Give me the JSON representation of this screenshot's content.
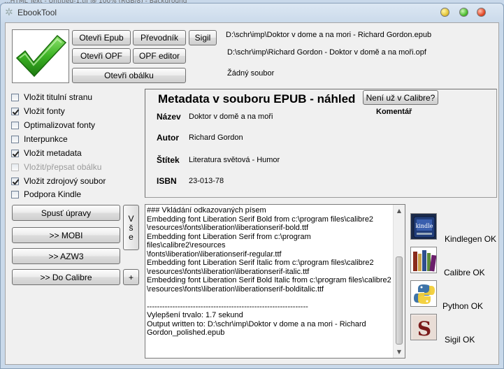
{
  "background_caption": "...HTML Text - Untitled-1.tif @ 100% (RGB/8) - Background",
  "window": {
    "title": "EbookTool"
  },
  "top_buttons": {
    "open_epub": "Otevři Epub",
    "converter": "Převodník",
    "sigil": "Sigil",
    "open_opf": "Otevři OPF",
    "opf_editor": "OPF editor",
    "open_cover": "Otevři obálku"
  },
  "paths": {
    "epub": "D:\\schr\\imp\\Doktor v dome a na mori - Richard Gordon.epub",
    "opf": "D:\\schr\\imp\\Richard Gordon - Doktor v domě a na moři.opf",
    "cover": "Žádný soubor"
  },
  "options": [
    {
      "label": "Vložit titulní stranu",
      "checked": false,
      "enabled": true
    },
    {
      "label": "Vložit fonty",
      "checked": true,
      "enabled": true
    },
    {
      "label": "Optimalizovat fonty",
      "checked": false,
      "enabled": true
    },
    {
      "label": "Interpunkce",
      "checked": false,
      "enabled": true
    },
    {
      "label": "Vložit metadata",
      "checked": true,
      "enabled": true
    },
    {
      "label": "Vložit/přepsat obálku",
      "checked": false,
      "enabled": false
    },
    {
      "label": "Vložit zdrojový soubor",
      "checked": true,
      "enabled": true
    },
    {
      "label": "Podpora Kindle",
      "checked": false,
      "enabled": true
    }
  ],
  "metadata": {
    "heading": "Metadata v souboru EPUB - náhled",
    "not_in_calibre_button": "Není už v Calibre?",
    "comment_label": "Komentář",
    "fields": [
      {
        "key": "Název",
        "value": "Doktor v domě a na moři"
      },
      {
        "key": "Autor",
        "value": "Richard Gordon"
      },
      {
        "key": "Štítek",
        "value": "Literatura světová - Humor"
      },
      {
        "key": "ISBN",
        "value": "23-013-78"
      }
    ]
  },
  "actions": {
    "run": "Spusť úpravy",
    "mobi": ">> MOBI",
    "azw3": ">> AZW3",
    "calibre": ">> Do Calibre",
    "all": "V\nš\ne",
    "plus": "+"
  },
  "log": "### Vkládání odkazovaných písem\nEmbedding font Liberation Serif Bold from c:\\program files\\calibre2\n\\resources\\fonts\\liberation\\liberationserif-bold.ttf\nEmbedding font Liberation Serif from c:\\program files\\calibre2\\resources\n\\fonts\\liberation\\liberationserif-regular.ttf\nEmbedding font Liberation Serif Italic from c:\\program files\\calibre2\n\\resources\\fonts\\liberation\\liberationserif-italic.ttf\nEmbedding font Liberation Serif Bold Italic from c:\\program files\\calibre2\n\\resources\\fonts\\liberation\\liberationserif-bolditalic.ttf\n\n---------------------------------------------------------------\nVylepšení trvalo: 1.7 sekund\nOutput written to: D:\\schr\\imp\\Doktor v dome a na mori - Richard\nGordon_polished.epub",
  "status": [
    {
      "icon": "kindle-icon",
      "label": "Kindlegen OK"
    },
    {
      "icon": "calibre-books-icon",
      "label": "Calibre OK"
    },
    {
      "icon": "python-icon",
      "label": "Python OK"
    },
    {
      "icon": "sigil-icon",
      "label": "Sigil OK"
    }
  ],
  "colors": {
    "check_green": "#2ea01e",
    "accent": "#3c7fb1"
  }
}
